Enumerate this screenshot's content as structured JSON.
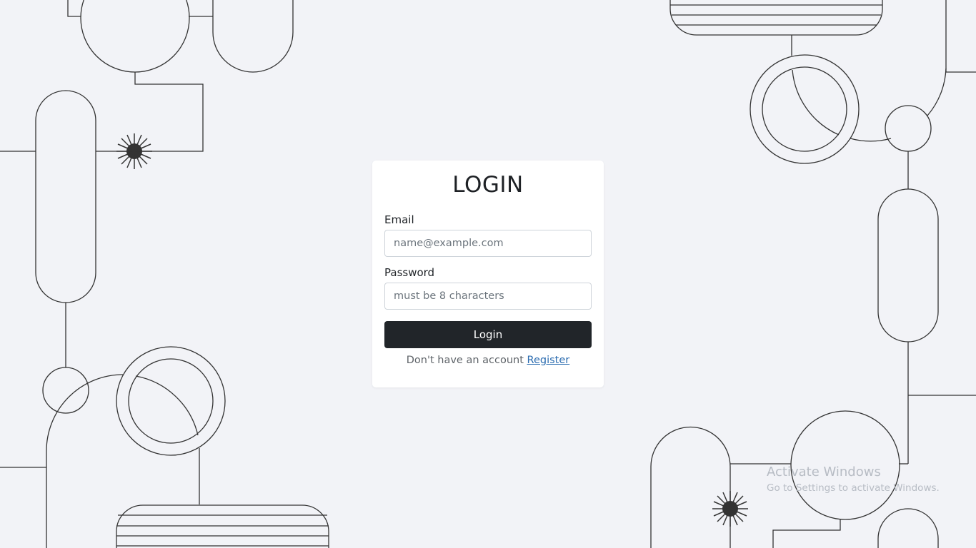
{
  "login_card": {
    "title": "LOGIN",
    "email": {
      "label": "Email",
      "placeholder": "name@example.com",
      "value": ""
    },
    "password": {
      "label": "Password",
      "placeholder": "must be 8 characters",
      "value": ""
    },
    "submit_label": "Login",
    "register_prompt": "Don't have an account",
    "register_link": "Register"
  },
  "watermark": {
    "title": "Activate Windows",
    "subtitle": "Go to Settings to activate Windows."
  },
  "colors": {
    "background": "#f2f3f7",
    "card": "#ffffff",
    "button": "#212529",
    "link": "#2b6cb0",
    "line_art": "#333333"
  }
}
